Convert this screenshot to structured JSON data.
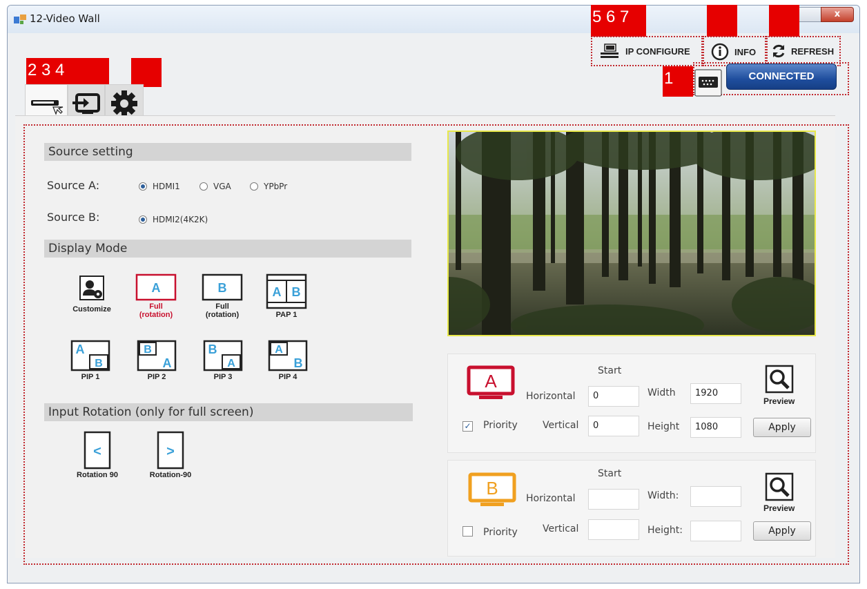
{
  "window": {
    "title": "12-Video Wall",
    "close_glyph": "x"
  },
  "callouts": {
    "c1": "1",
    "c234": "2 3 4",
    "c567": "5 6 7"
  },
  "toolbar": {
    "ip_configure": "IP CONFIGURE",
    "info": "INFO",
    "refresh": "REFRESH",
    "connected": "CONNECTED"
  },
  "source_setting": {
    "header": "Source setting",
    "source_a_label": "Source A:",
    "source_a_options": [
      "HDMI1",
      "VGA",
      "YPbPr"
    ],
    "source_a_selected": "HDMI1",
    "source_b_label": "Source B:",
    "source_b_options": [
      "HDMI2(4K2K)"
    ],
    "source_b_selected": "HDMI2(4K2K)"
  },
  "display_mode": {
    "header": "Display Mode",
    "customize": "Customize",
    "full_a_line1": "Full",
    "full_a_line2": "(rotation)",
    "full_b_line1": "Full",
    "full_b_line2": "(rotation)",
    "pap1": "PAP 1",
    "pip1": "PIP 1",
    "pip2": "PIP 2",
    "pip3": "PIP 3",
    "pip4": "PIP 4",
    "icon_letter_a": "A",
    "icon_letter_b": "B"
  },
  "input_rotation": {
    "header": "Input Rotation (only for full screen)",
    "rot90": "Rotation 90",
    "rotm90": "Rotation-90",
    "rot90_glyph": "<",
    "rotm90_glyph": ">"
  },
  "source_a_box": {
    "letter": "A",
    "start_label": "Start",
    "horizontal_label": "Horizontal",
    "horizontal_value": "0",
    "vertical_label": "Vertical",
    "vertical_value": "0",
    "width_label": "Width",
    "width_value": "1920",
    "height_label": "Height",
    "height_value": "1080",
    "priority_label": "Priority",
    "priority_checked": true,
    "preview_label": "Preview",
    "apply_label": "Apply",
    "color": "#c8102e"
  },
  "source_b_box": {
    "letter": "B",
    "start_label": "Start",
    "horizontal_label": "Horizontal",
    "horizontal_value": "",
    "vertical_label": "Vertical",
    "vertical_value": "",
    "width_label": "Width:",
    "width_value": "",
    "height_label": "Height:",
    "height_value": "",
    "priority_label": "Priority",
    "priority_checked": false,
    "preview_label": "Preview",
    "apply_label": "Apply",
    "color": "#f0a020"
  },
  "colors": {
    "accent_red": "#e60000",
    "dotted": "#c1272d",
    "connected_blue": "#1f4e9e",
    "selected_mode": "#c8102e",
    "mode_letter": "#3aa0d8"
  }
}
